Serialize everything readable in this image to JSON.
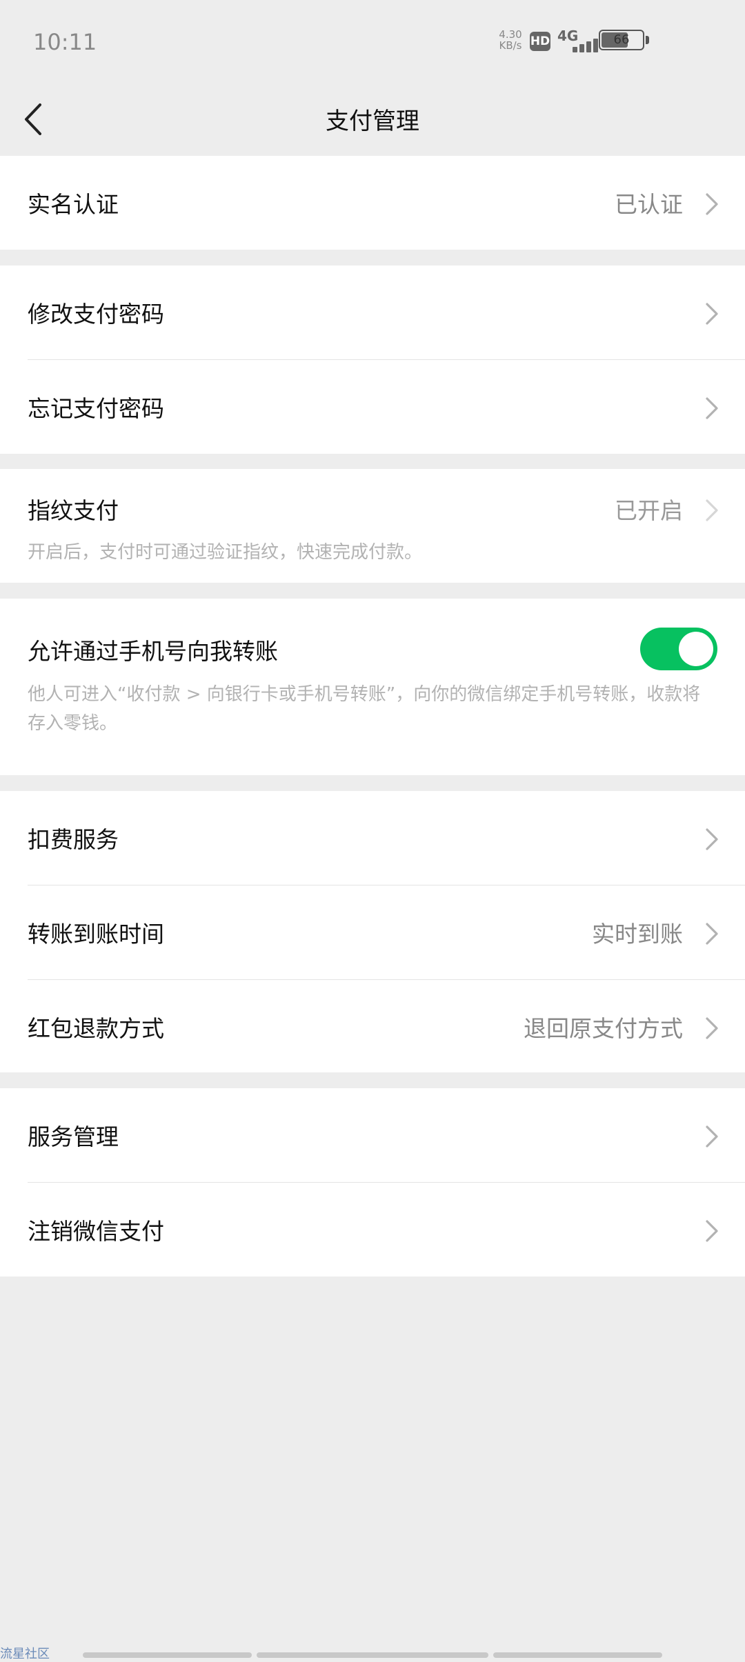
{
  "status_bar": {
    "time": "10:11",
    "speed_value": "4.30",
    "speed_unit": "KB/s",
    "hd": "HD",
    "network": "4G",
    "battery": "66"
  },
  "header": {
    "title": "支付管理"
  },
  "rows": {
    "real_name": {
      "label": "实名认证",
      "value": "已认证"
    },
    "change_password": {
      "label": "修改支付密码"
    },
    "forgot_password": {
      "label": "忘记支付密码"
    },
    "fingerprint": {
      "label": "指纹支付",
      "value": "已开启",
      "desc": "开启后，支付时可通过验证指纹，快速完成付款。"
    },
    "phone_transfer": {
      "label": "允许通过手机号向我转账",
      "toggle_on": true,
      "desc": "他人可进入“收付款 > 向银行卡或手机号转账”，向你的微信绑定手机号转账，收款将存入零钱。"
    },
    "deduction": {
      "label": "扣费服务"
    },
    "transfer_time": {
      "label": "转账到账时间",
      "value": "实时到账"
    },
    "red_packet_refund": {
      "label": "红包退款方式",
      "value": "退回原支付方式"
    },
    "service_management": {
      "label": "服务管理"
    },
    "cancel_wechat_pay": {
      "label": "注销微信支付"
    }
  },
  "footer": {
    "watermark": "流星社区"
  },
  "colors": {
    "accent": "#07c160",
    "background": "#ededed",
    "secondary_text": "#888888"
  }
}
